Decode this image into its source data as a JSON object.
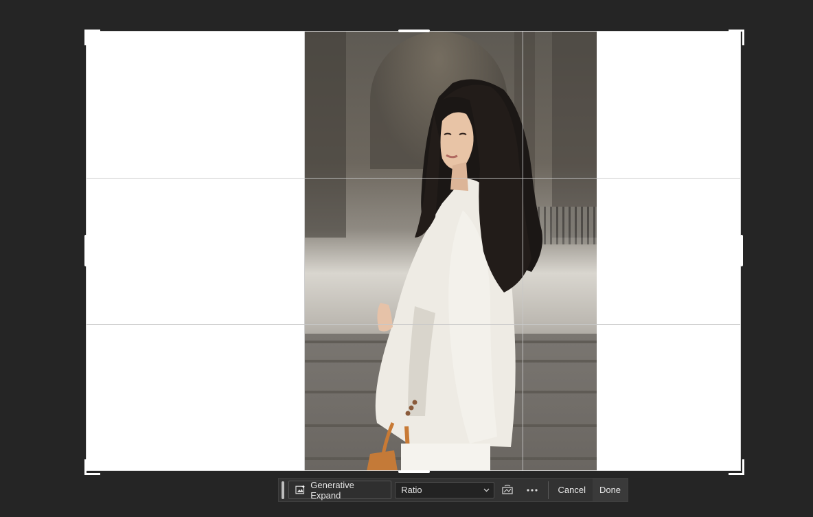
{
  "toolbar": {
    "generative_expand_label": "Generative Expand",
    "ratio_value": "Ratio",
    "cancel_label": "Cancel",
    "done_label": "Done",
    "icons": {
      "generative_expand": "generative-expand-icon",
      "straighten": "straighten-icon",
      "more": "more-icon",
      "dropdown": "chevron-down-icon"
    }
  },
  "colors": {
    "background": "#252525",
    "toolbar": "#323232",
    "canvas_fill": "#ffffff"
  }
}
